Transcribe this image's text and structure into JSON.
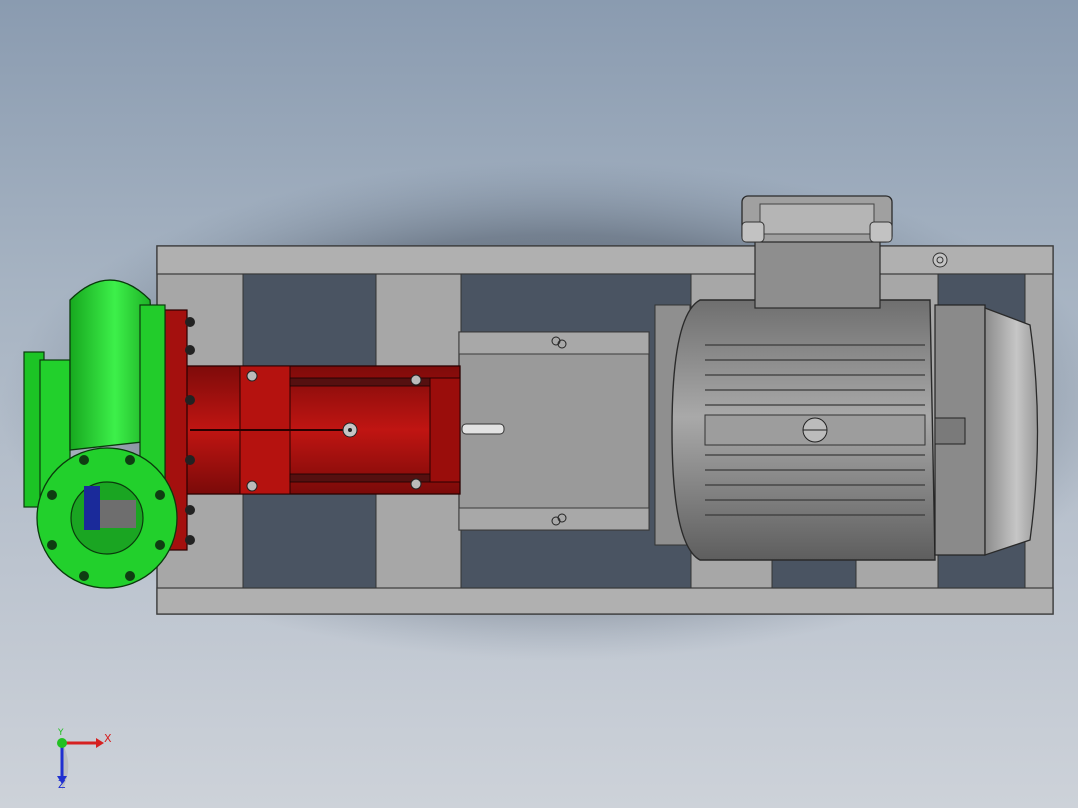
{
  "viewport": {
    "colors": {
      "background_top": "#8a9bb0",
      "background_bottom": "#cdd2d9",
      "frame": "#a9a9a9",
      "motor": "#8f8f8f",
      "pump_casing": "#1fd22a",
      "bearing_frame": "#a4100e",
      "coupling_guard": "#9a9a9a"
    },
    "parts": {
      "base_frame": "base-frame",
      "pump_casing": "pump-casing",
      "bearing_housing": "bearing-housing",
      "coupling_guard": "coupling-guard",
      "motor": "electric-motor",
      "terminal_box": "terminal-box",
      "fan_cover": "fan-cover"
    }
  },
  "triad": {
    "x_label": "X",
    "y_label": "Y",
    "z_label": "Z",
    "x_color": "#d62020",
    "y_color": "#22c022",
    "z_color": "#2030d0"
  }
}
